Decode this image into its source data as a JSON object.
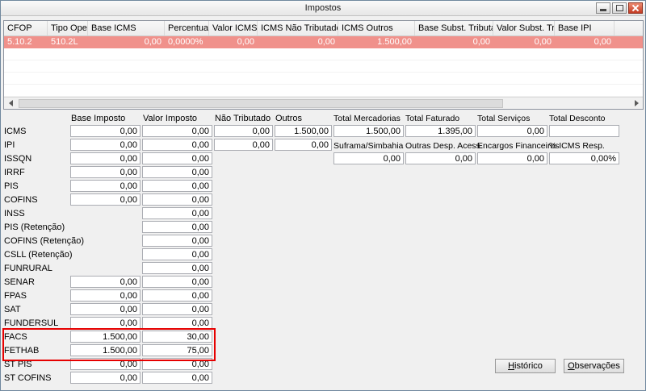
{
  "window": {
    "title": "Impostos"
  },
  "grid": {
    "columns": [
      "CFOP",
      "Tipo Oper.",
      "Base ICMS",
      "Percentual",
      "Valor ICMS",
      "ICMS Não Tributado",
      "ICMS Outros",
      "Base Subst. Tributária",
      "Valor Subst. Trib.",
      "Base IPI"
    ],
    "selected_row": [
      "5.10.2",
      "510.2L",
      "0,00",
      "0,0000%",
      "0,00",
      "0,00",
      "1.500,00",
      "0,00",
      "0,00",
      "0,00"
    ],
    "empty_row_count": 4
  },
  "form": {
    "column_headers": [
      "Base Imposto",
      "Valor Imposto",
      "Não Tributado",
      "Outros"
    ],
    "rows": [
      {
        "label": "ICMS",
        "base": "0,00",
        "valor": "0,00",
        "nao_tributado": "0,00",
        "outros": "1.500,00"
      },
      {
        "label": "IPI",
        "base": "0,00",
        "valor": "0,00",
        "nao_tributado": "0,00",
        "outros": "0,00"
      },
      {
        "label": "ISSQN",
        "base": "0,00",
        "valor": "0,00"
      },
      {
        "label": "IRRF",
        "base": "0,00",
        "valor": "0,00"
      },
      {
        "label": "PIS",
        "base": "0,00",
        "valor": "0,00"
      },
      {
        "label": "COFINS",
        "base": "0,00",
        "valor": "0,00"
      },
      {
        "label": "INSS",
        "valor": "0,00"
      },
      {
        "label": "PIS (Retenção)",
        "valor": "0,00"
      },
      {
        "label": "COFINS (Retenção)",
        "valor": "0,00"
      },
      {
        "label": "CSLL (Retenção)",
        "valor": "0,00"
      },
      {
        "label": "FUNRURAL",
        "valor": "0,00"
      },
      {
        "label": "SENAR",
        "base": "0,00",
        "valor": "0,00"
      },
      {
        "label": "FPAS",
        "base": "0,00",
        "valor": "0,00"
      },
      {
        "label": "SAT",
        "base": "0,00",
        "valor": "0,00"
      },
      {
        "label": "FUNDERSUL",
        "base": "0,00",
        "valor": "0,00"
      },
      {
        "label": "FACS",
        "base": "1.500,00",
        "valor": "30,00",
        "highlighted": true
      },
      {
        "label": "FETHAB",
        "base": "1.500,00",
        "valor": "75,00",
        "highlighted": true
      },
      {
        "label": "ST PIS",
        "base": "0,00",
        "valor": "0,00"
      },
      {
        "label": "ST COFINS",
        "base": "0,00",
        "valor": "0,00"
      }
    ]
  },
  "totals": {
    "headers": [
      "Total Mercadorias",
      "Total Faturado",
      "Total Serviços",
      "Total Desconto"
    ],
    "values": [
      "1.500,00",
      "1.395,00",
      "0,00",
      ""
    ],
    "headers2": [
      "Suframa/Simbahia",
      "Outras Desp. Acess.",
      "Encargos Financeiros",
      "% ICMS Resp."
    ],
    "values2": [
      "0,00",
      "0,00",
      "0,00",
      "0,00%"
    ]
  },
  "buttons": [
    {
      "name": "historico",
      "mnemonic": "H",
      "rest": "istórico"
    },
    {
      "name": "observacoes",
      "mnemonic": "O",
      "rest": "bservações"
    }
  ],
  "annotation": {
    "color": "#e60000"
  }
}
